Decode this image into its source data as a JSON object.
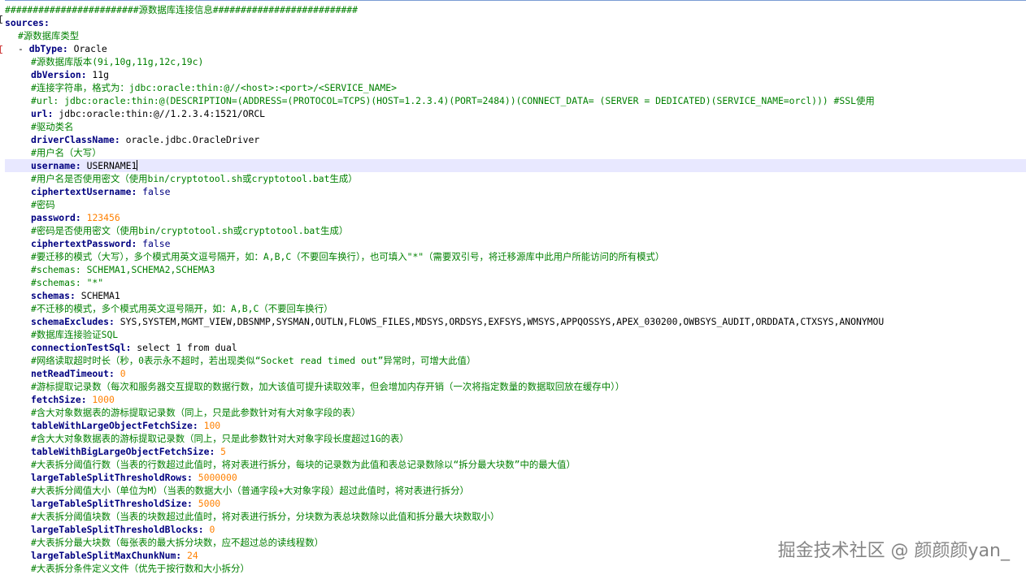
{
  "lines": [
    {
      "kind": "comment",
      "indent": 0,
      "text": "########################源数据库连接信息##########################"
    },
    {
      "kind": "key",
      "indent": 0,
      "key": "sources:",
      "value": ""
    },
    {
      "kind": "comment",
      "indent": 1,
      "text": "#源数据库类型"
    },
    {
      "kind": "listkey",
      "indent": 1,
      "dash": "- ",
      "key": "dbType:",
      "value": " Oracle"
    },
    {
      "kind": "comment",
      "indent": 2,
      "text": "#源数据库版本(9i,10g,11g,12c,19c)"
    },
    {
      "kind": "key",
      "indent": 2,
      "key": "dbVersion:",
      "value": " 11g"
    },
    {
      "kind": "comment",
      "indent": 2,
      "text": "#连接字符串，格式为：jdbc:oracle:thin:@//<host>:<port>/<SERVICE_NAME>"
    },
    {
      "kind": "comment",
      "indent": 2,
      "text": "#url: jdbc:oracle:thin:@(DESCRIPTION=(ADDRESS=(PROTOCOL=TCPS)(HOST=1.2.3.4)(PORT=2484))(CONNECT_DATA= (SERVER = DEDICATED)(SERVICE_NAME=orcl))) #SSL使用"
    },
    {
      "kind": "key",
      "indent": 2,
      "key": "url:",
      "value": " jdbc:oracle:thin:@//1.2.3.4:1521/ORCL"
    },
    {
      "kind": "comment",
      "indent": 2,
      "text": "#驱动类名"
    },
    {
      "kind": "key",
      "indent": 2,
      "key": "driverClassName:",
      "value": " oracle.jdbc.OracleDriver"
    },
    {
      "kind": "comment",
      "indent": 2,
      "text": "#用户名（大写）"
    },
    {
      "kind": "key",
      "indent": 2,
      "key": "username:",
      "value": " USERNAME1",
      "current": true
    },
    {
      "kind": "comment",
      "indent": 2,
      "text": "#用户名是否使用密文（使用bin/cryptotool.sh或cryptotool.bat生成）"
    },
    {
      "kind": "keybool",
      "indent": 2,
      "key": "ciphertextUsername:",
      "value": " false"
    },
    {
      "kind": "comment",
      "indent": 2,
      "text": "#密码"
    },
    {
      "kind": "keynum",
      "indent": 2,
      "key": "password:",
      "value": " 123456"
    },
    {
      "kind": "comment",
      "indent": 2,
      "text": "#密码是否使用密文（使用bin/cryptotool.sh或cryptotool.bat生成）"
    },
    {
      "kind": "keybool",
      "indent": 2,
      "key": "ciphertextPassword:",
      "value": " false"
    },
    {
      "kind": "comment",
      "indent": 2,
      "text": "#要迁移的模式（大写），多个模式用英文逗号隔开，如：A,B,C（不要回车换行），也可填入\"*\"（需要双引号，将迁移源库中此用户所能访问的所有模式）"
    },
    {
      "kind": "comment",
      "indent": 2,
      "text": "#schemas: SCHEMA1,SCHEMA2,SCHEMA3"
    },
    {
      "kind": "comment",
      "indent": 2,
      "text": "#schemas: \"*\""
    },
    {
      "kind": "key",
      "indent": 2,
      "key": "schemas:",
      "value": " SCHEMA1"
    },
    {
      "kind": "comment",
      "indent": 2,
      "text": "#不迁移的模式，多个模式用英文逗号隔开，如：A,B,C（不要回车换行）"
    },
    {
      "kind": "key",
      "indent": 2,
      "key": "schemaExcludes:",
      "value": " SYS,SYSTEM,MGMT_VIEW,DBSNMP,SYSMAN,OUTLN,FLOWS_FILES,MDSYS,ORDSYS,EXFSYS,WMSYS,APPQOSSYS,APEX_030200,OWBSYS_AUDIT,ORDDATA,CTXSYS,ANONYMOU"
    },
    {
      "kind": "comment",
      "indent": 2,
      "text": "#数据库连接验证SQL"
    },
    {
      "kind": "key",
      "indent": 2,
      "key": "connectionTestSql:",
      "value": " select 1 from dual"
    },
    {
      "kind": "comment",
      "indent": 2,
      "text": "#网络读取超时时长（秒，0表示永不超时，若出现类似“Socket read timed out”异常时，可增大此值）"
    },
    {
      "kind": "keynum",
      "indent": 2,
      "key": "netReadTimeout:",
      "value": " 0"
    },
    {
      "kind": "comment",
      "indent": 2,
      "text": "#游标提取记录数（每次和服务器交互提取的数据行数，加大该值可提升读取效率，但会增加内存开销（一次将指定数量的数据取回放在缓存中））"
    },
    {
      "kind": "keynum",
      "indent": 2,
      "key": "fetchSize:",
      "value": " 1000"
    },
    {
      "kind": "comment",
      "indent": 2,
      "text": "#含大对象数据表的游标提取记录数（同上，只是此参数针对有大对象字段的表）"
    },
    {
      "kind": "keynum",
      "indent": 2,
      "key": "tableWithLargeObjectFetchSize:",
      "value": " 100"
    },
    {
      "kind": "comment",
      "indent": 2,
      "text": "#含大大对象数据表的游标提取记录数（同上，只是此参数针对大对象字段长度超过1G的表）"
    },
    {
      "kind": "keynum",
      "indent": 2,
      "key": "tableWithBigLargeObjectFetchSize:",
      "value": " 5"
    },
    {
      "kind": "comment",
      "indent": 2,
      "text": "#大表拆分阈值行数（当表的行数超过此值时，将对表进行拆分，每块的记录数为此值和表总记录数除以“拆分最大块数”中的最大值）"
    },
    {
      "kind": "keynum",
      "indent": 2,
      "key": "largeTableSplitThresholdRows:",
      "value": " 5000000"
    },
    {
      "kind": "comment",
      "indent": 2,
      "text": "#大表拆分阈值大小（单位为M）（当表的数据大小（普通字段+大对象字段）超过此值时，将对表进行拆分）"
    },
    {
      "kind": "keynum",
      "indent": 2,
      "key": "largeTableSplitThresholdSize:",
      "value": " 5000"
    },
    {
      "kind": "comment",
      "indent": 2,
      "text": "#大表拆分阈值块数（当表的块数超过此值时，将对表进行拆分，分块数为表总块数除以此值和拆分最大块数取小）"
    },
    {
      "kind": "keynum",
      "indent": 2,
      "key": "largeTableSplitThresholdBlocks:",
      "value": " 0"
    },
    {
      "kind": "comment",
      "indent": 2,
      "text": "#大表拆分最大块数（每张表的最大拆分块数，应不超过总的读线程数）"
    },
    {
      "kind": "keynum",
      "indent": 2,
      "key": "largeTableSplitMaxChunkNum:",
      "value": " 24"
    },
    {
      "kind": "comment",
      "indent": 2,
      "text": "#大表拆分条件定义文件（优先于按行数和大小拆分）"
    }
  ],
  "watermark": "掘金技术社区 @ 颜颜颜yan_"
}
